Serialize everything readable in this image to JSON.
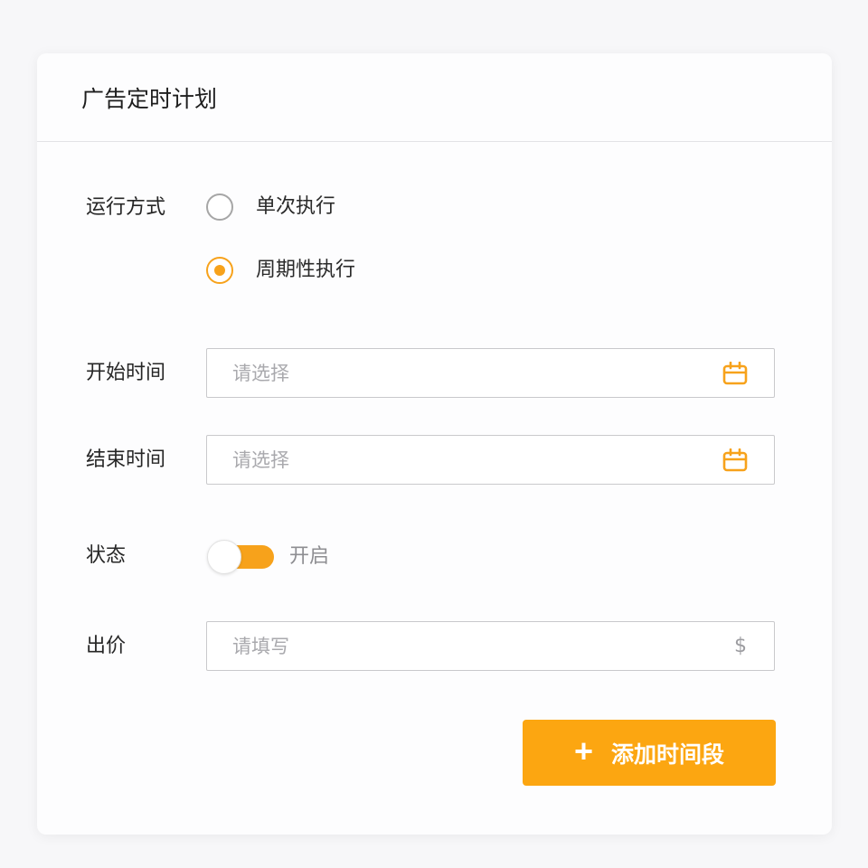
{
  "card": {
    "title": "广告定时计划"
  },
  "form": {
    "run_mode": {
      "label": "运行方式",
      "options": [
        {
          "label": "单次执行",
          "checked": false
        },
        {
          "label": "周期性执行",
          "checked": true
        }
      ]
    },
    "start_time": {
      "label": "开始时间",
      "placeholder": "请选择",
      "value": "",
      "icon": "calendar-icon"
    },
    "end_time": {
      "label": "结束时间",
      "placeholder": "请选择",
      "value": "",
      "icon": "calendar-icon"
    },
    "status": {
      "label": "状态",
      "toggle_on": true,
      "toggle_text": "开启"
    },
    "bid": {
      "label": "出价",
      "placeholder": "请填写",
      "value": "",
      "suffix": "$"
    }
  },
  "actions": {
    "add_button_icon": "+",
    "add_button_label": "添加时间段"
  },
  "colors": {
    "accent": "#f7a21b",
    "button": "#fca611",
    "border": "#c9c9cc",
    "placeholder": "#a9a9ad"
  }
}
